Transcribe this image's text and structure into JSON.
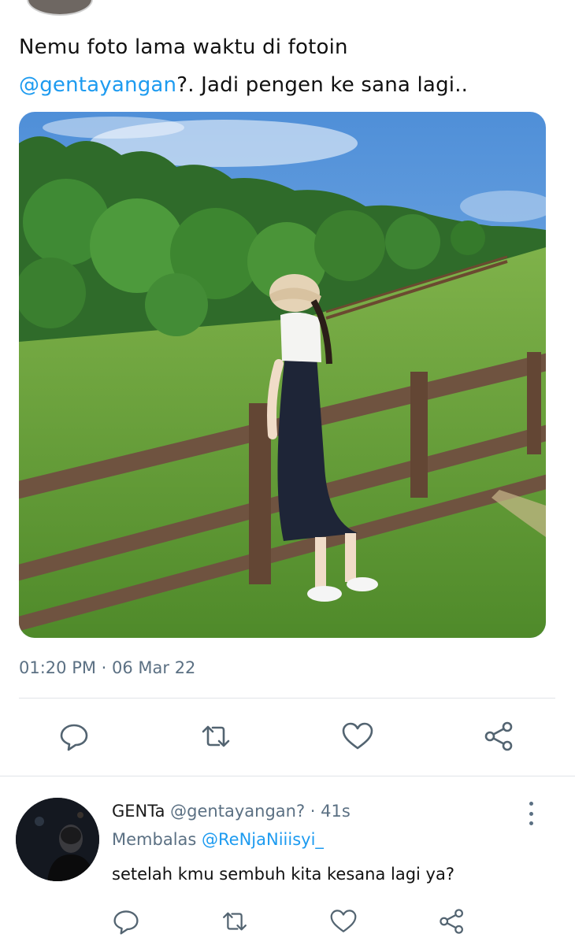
{
  "tweet": {
    "text_line1": "Nemu foto lama waktu di fotoin",
    "mention": "@gentayangan",
    "text_line2_rest": "?. Jadi pengen ke sana lagi..",
    "timestamp": "01:20 PM · 06 Mar 22"
  },
  "reply": {
    "display_name": "GENTa",
    "handle": "@gentayangan?",
    "time": " · 41s",
    "replying_label": "Membalas",
    "replying_to": "@ReNjaNiiisyi_",
    "text": "setelah kmu sembuh kita kesana lagi ya?"
  },
  "icons": {
    "reply": "reply-bubble-icon",
    "retweet": "retweet-icon",
    "like": "heart-icon",
    "share": "share-icon",
    "more": "more-vertical-icon"
  },
  "colors": {
    "accent": "#1d9bf0",
    "muted": "#5b7083",
    "icon": "#536471"
  }
}
